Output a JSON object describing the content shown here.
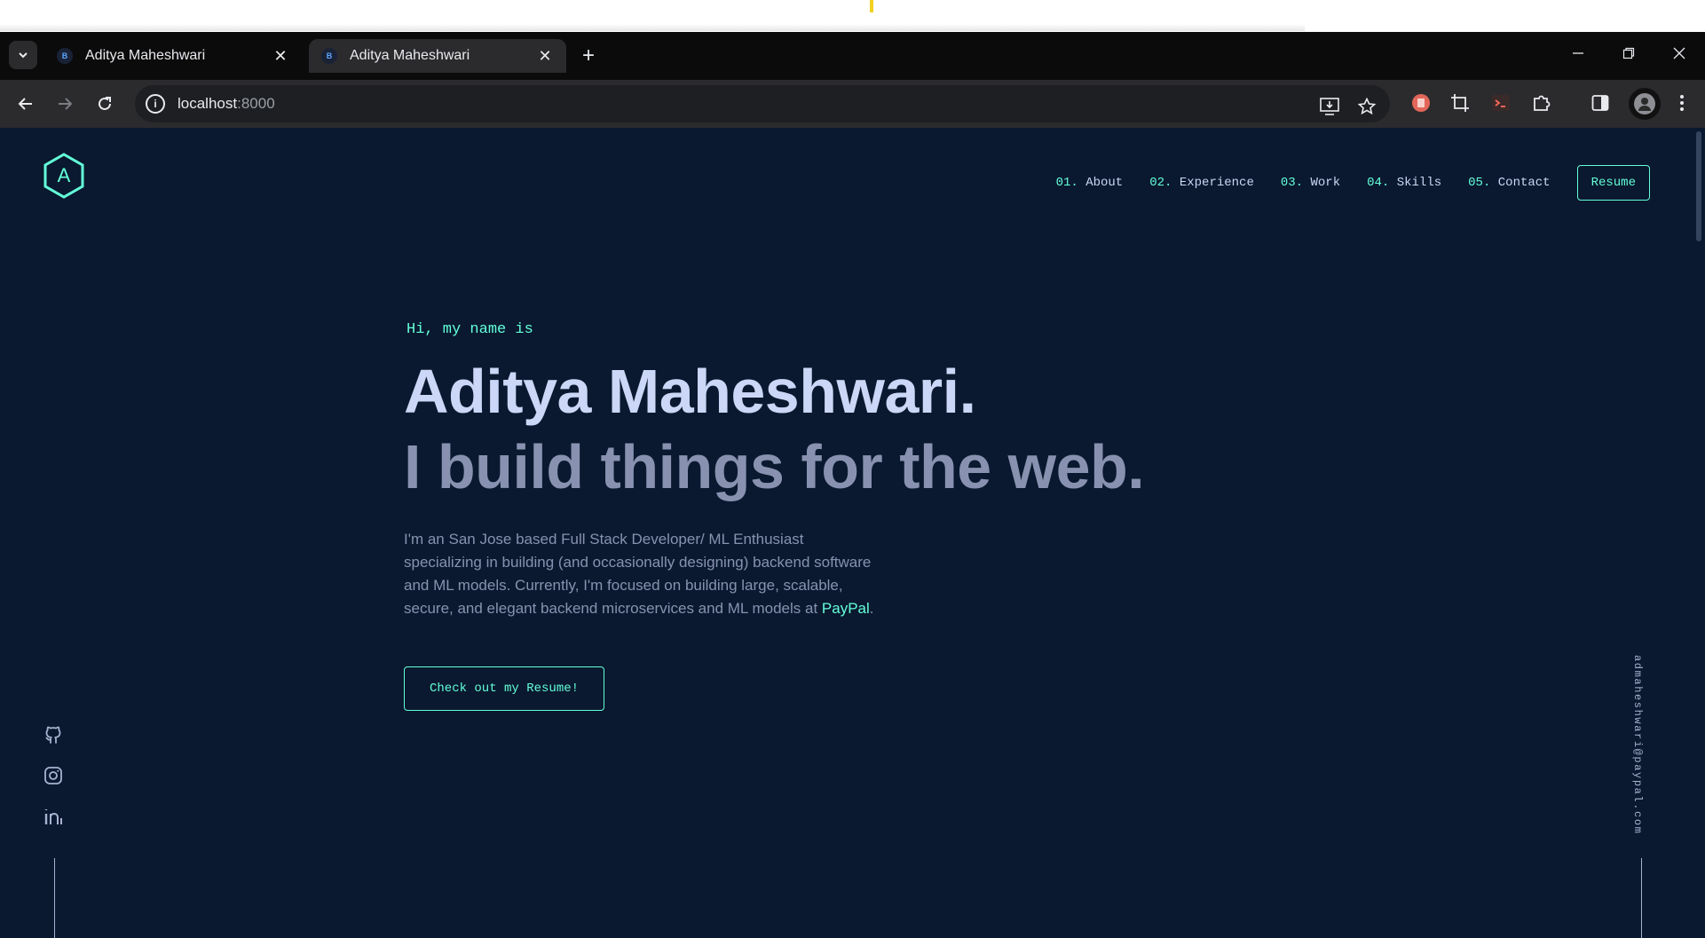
{
  "browser": {
    "tabs": [
      {
        "title": "Aditya Maheshwari",
        "favicon": "B",
        "active": false
      },
      {
        "title": "Aditya Maheshwari",
        "favicon": "B",
        "active": true
      }
    ],
    "url_host": "localhost",
    "url_port": ":8000"
  },
  "site": {
    "logo_letter": "A",
    "nav": [
      {
        "num": "01.",
        "label": "About"
      },
      {
        "num": "02.",
        "label": "Experience"
      },
      {
        "num": "03.",
        "label": "Work"
      },
      {
        "num": "04.",
        "label": "Skills"
      },
      {
        "num": "05.",
        "label": "Contact"
      }
    ],
    "resume_label": "Resume",
    "hero": {
      "greeting": "Hi, my name is",
      "name": "Aditya Maheshwari.",
      "tagline": "I build things for the web.",
      "bio_before": "I'm an San Jose based Full Stack Developer/ ML Enthusiast specializing in building (and occasionally designing) backend software and ML models. Currently, I'm focused on building large, scalable, secure, and elegant backend microservices and ML models at ",
      "bio_highlight": "PayPal",
      "bio_after": ".",
      "cta_label": "Check out my Resume!"
    },
    "email": "admaheshwari@paypal.com",
    "socials": [
      "github-icon",
      "instagram-icon",
      "linkedin-icon"
    ]
  },
  "colors": {
    "background": "#0a192f",
    "accent": "#64ffda",
    "heading": "#ccd6f6",
    "text": "#8892b0"
  }
}
